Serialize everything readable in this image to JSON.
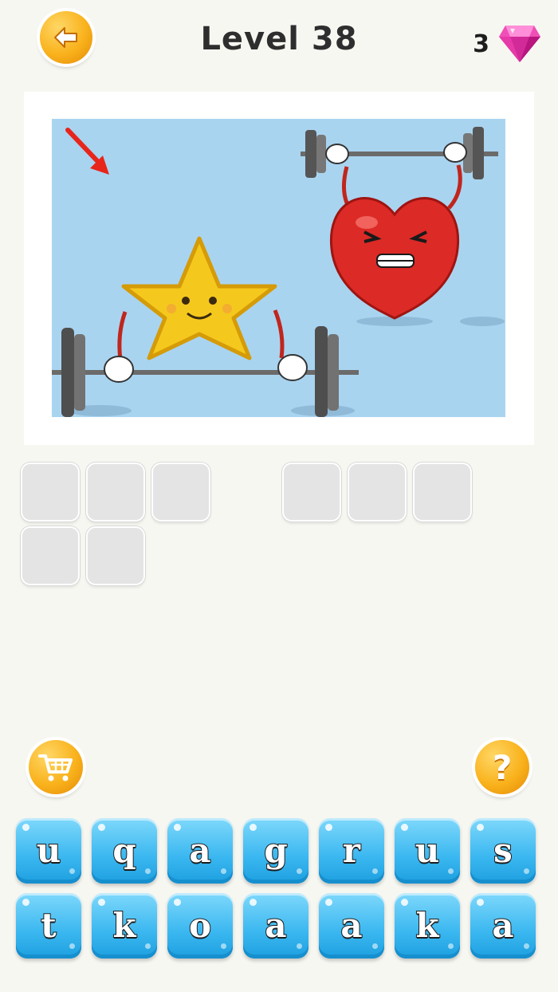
{
  "header": {
    "title": "Level 38",
    "gems": "3",
    "gem_color": "#e63aa8",
    "back_icon": "arrow-left-icon"
  },
  "puzzle": {
    "image_icons": [
      "arrow-icon",
      "star-character",
      "heart-character",
      "barbell"
    ],
    "answer_words": [
      {
        "length": 3
      },
      {
        "length": 3
      },
      {
        "length": 2
      }
    ]
  },
  "controls": {
    "shop_icon": "cart-icon",
    "hint_label": "?"
  },
  "keyboard": {
    "row1": [
      "u",
      "q",
      "a",
      "g",
      "r",
      "u",
      "s"
    ],
    "row2": [
      "t",
      "k",
      "o",
      "a",
      "a",
      "k",
      "a"
    ]
  }
}
